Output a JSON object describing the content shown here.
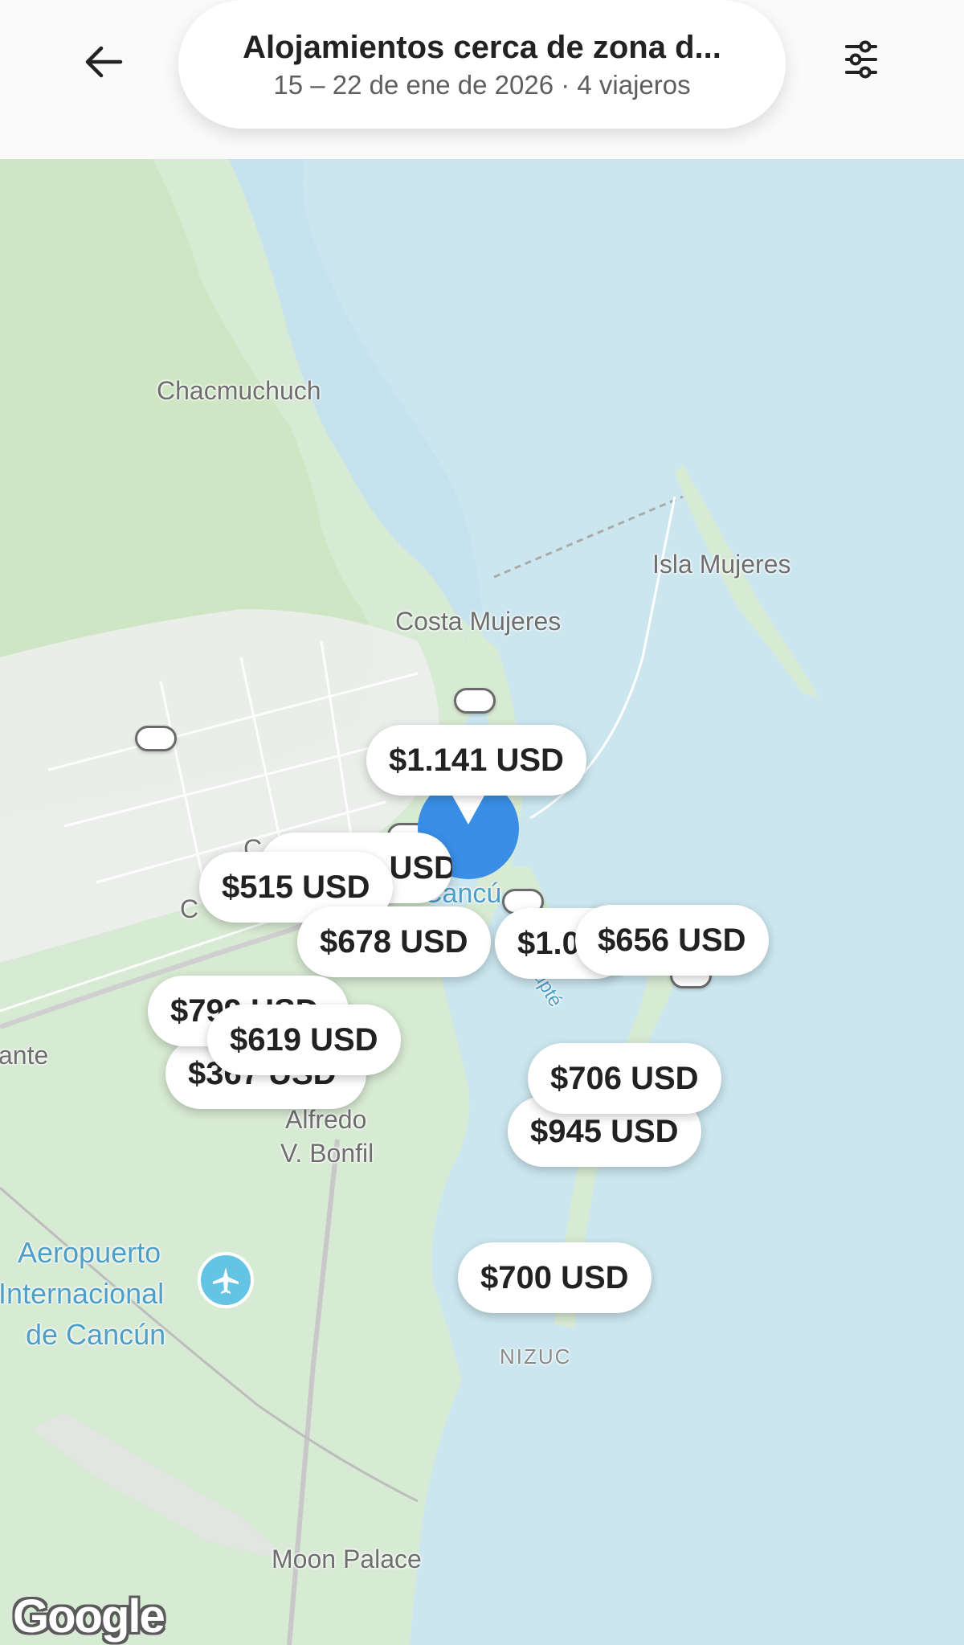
{
  "header": {
    "back_icon": "arrow-left-icon",
    "search_title": "Alojamientos cerca de zona d...",
    "search_subtitle": "15 – 22 de ene de 2026 · 4 viajeros",
    "filter_icon": "sliders-icon"
  },
  "map": {
    "labels": {
      "chacmuchuch": "Chacmuchuch",
      "isla_mujeres": "Isla Mujeres",
      "costa_mujeres": "Costa Mujeres",
      "alfredo_1": "Alfredo",
      "alfredo_2": "V. Bonfil",
      "airport_1": "Aeropuerto",
      "airport_2": "Internacional",
      "airport_3": "de Cancún",
      "nizuc": "NIZUC",
      "moon_palace": "Moon Palace",
      "left_edge": "ante",
      "cancun_partial": "Cancú",
      "nichupte_partial": "hupté",
      "c_partial_1": "C",
      "c_partial_2": "C"
    },
    "prices": [
      "$1.141 USD",
      "$1.000 USD",
      "$515 USD",
      "$678 USD",
      "$1.0",
      "$656 USD",
      "$799 USD",
      "$367 USD",
      "$619 USD",
      "$706 USD",
      "$945 USD",
      "$700 USD"
    ],
    "attribution": "Google"
  }
}
